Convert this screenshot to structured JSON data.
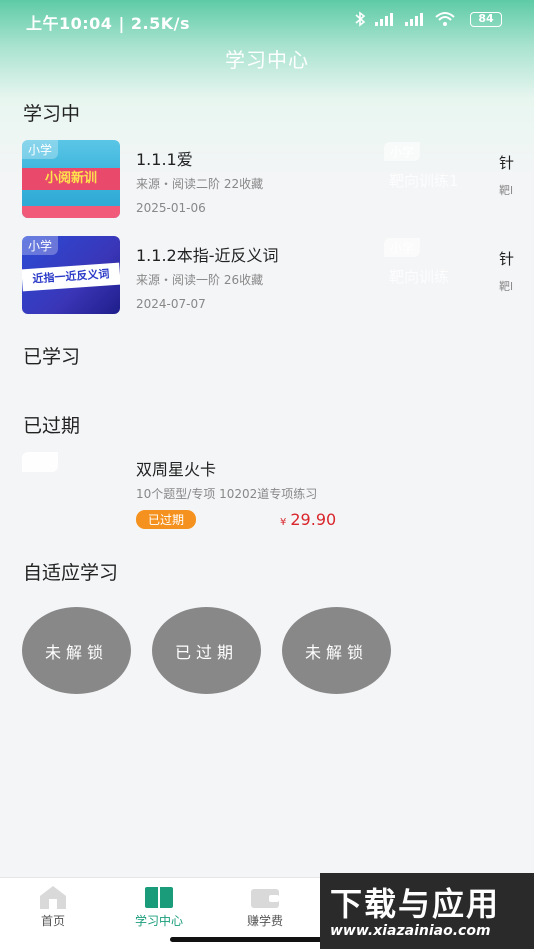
{
  "status_bar": {
    "time_speed": "上午10:04 | 2.5K/s",
    "battery": "84"
  },
  "header": {
    "title": "学习中心"
  },
  "sections": {
    "learning": "学习中",
    "learned": "已学习",
    "expired": "已过期",
    "adaptive": "自适应学习"
  },
  "learning_courses": [
    {
      "tag": "小学",
      "thumb_text": "小阅新训",
      "name": "1.1.1爱",
      "meta": "来源・阅读二阶  22收藏",
      "date": "2025-01-06",
      "ghost_tag": "小学",
      "ghost_text": "靶向训练1",
      "peek_name": "针",
      "peek_meta": "靶l"
    },
    {
      "tag": "小学",
      "thumb_text": "近指一近反义词",
      "name": "1.1.2本指-近反义词",
      "meta": "来源・阅读一阶  26收藏",
      "date": "2024-07-07",
      "ghost_tag": "小学",
      "ghost_text": "靶向训练",
      "peek_name": "针",
      "peek_meta": "靶l"
    }
  ],
  "expired_card": {
    "name": "双周星火卡",
    "meta": "10个题型/专项  10202道专项练习",
    "badge": "已过期",
    "currency": "¥",
    "price": "29.90"
  },
  "adaptive_buttons": [
    "未解锁",
    "已过期",
    "未解锁"
  ],
  "tabbar": {
    "items": [
      {
        "label": "首页",
        "icon": "home-icon"
      },
      {
        "label": "学习中心",
        "icon": "book-icon"
      },
      {
        "label": "赚学费",
        "icon": "wallet-icon"
      }
    ],
    "active_index": 1
  },
  "watermark": {
    "big": "下载与应用",
    "small": "www.xiazainiao.com"
  },
  "colors": {
    "accent": "#1a9c7b",
    "header_green": "#5ecba6",
    "price": "#d9262c",
    "expired_badge": "#f5921f",
    "circle_button": "#888888"
  }
}
